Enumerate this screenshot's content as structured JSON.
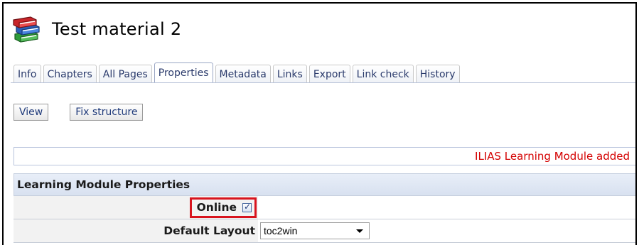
{
  "header": {
    "icon": "books-icon",
    "title": "Test material 2"
  },
  "tabs": [
    {
      "label": "Info",
      "active": false
    },
    {
      "label": "Chapters",
      "active": false
    },
    {
      "label": "All Pages",
      "active": false
    },
    {
      "label": "Properties",
      "active": true
    },
    {
      "label": "Metadata",
      "active": false
    },
    {
      "label": "Links",
      "active": false
    },
    {
      "label": "Export",
      "active": false
    },
    {
      "label": "Link check",
      "active": false
    },
    {
      "label": "History",
      "active": false
    }
  ],
  "toolbar": {
    "view_label": "View",
    "fix_structure_label": "Fix structure"
  },
  "message": {
    "text": "ILIAS Learning Module added",
    "color": "#d40000"
  },
  "form": {
    "header": "Learning Module Properties",
    "online_label": "Online",
    "online_checked": true,
    "default_layout_label": "Default Layout",
    "default_layout_value": "toc2win"
  },
  "colors": {
    "highlight": "#d8141e",
    "tab_text": "#2a3a6b",
    "section_header_bg": "#dde5f3"
  }
}
